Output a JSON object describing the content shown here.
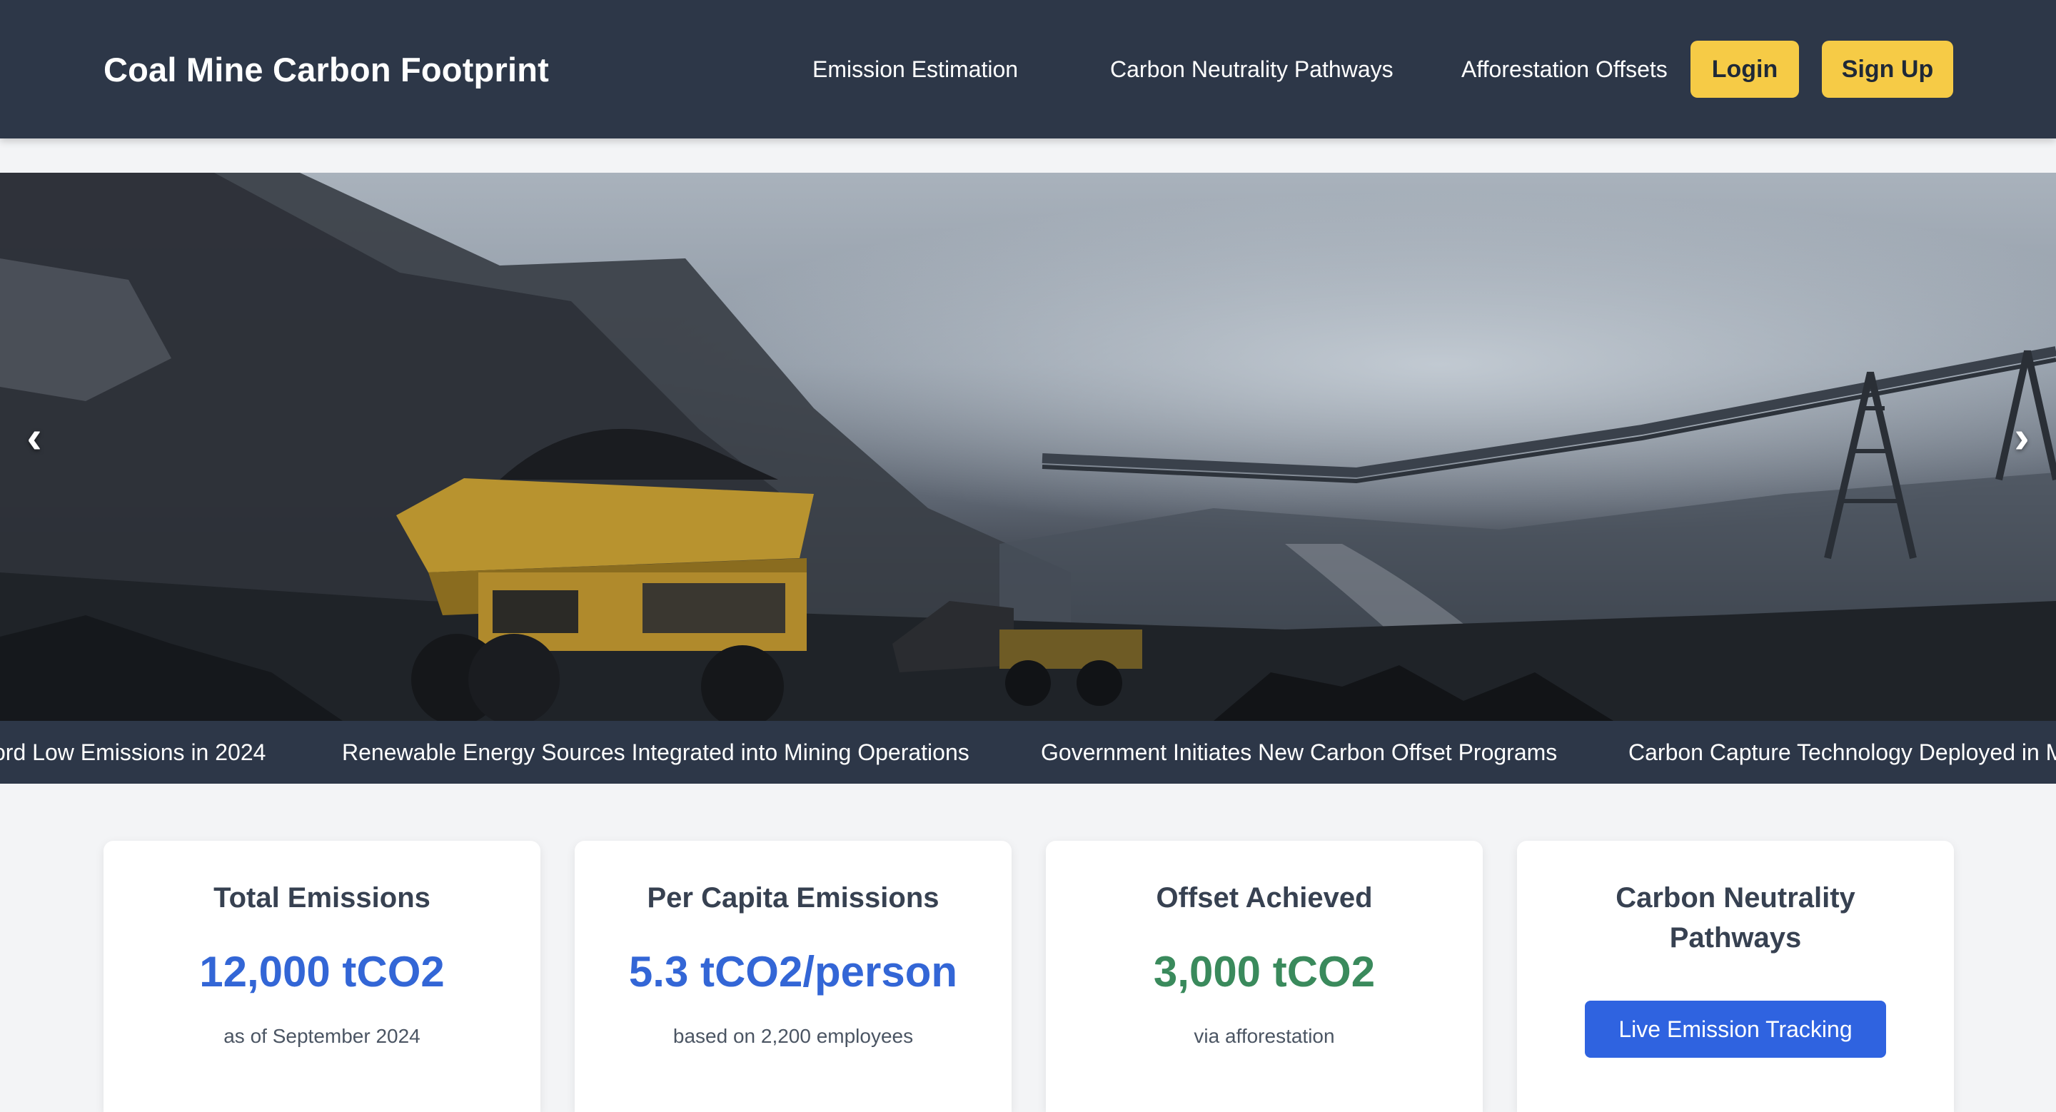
{
  "header": {
    "brand": "Coal Mine Carbon Footprint",
    "nav": [
      "Emission Estimation",
      "Carbon Neutrality Pathways",
      "Afforestation Offsets"
    ],
    "login_label": "Login",
    "signup_label": "Sign Up",
    "accent_color": "#f6cb46",
    "bg_color": "#2d3748"
  },
  "hero": {
    "prev_icon": "‹",
    "next_icon": "›"
  },
  "ticker": {
    "items": [
      "ord Low Emissions in 2024",
      "Renewable Energy Sources Integrated into Mining Operations",
      "Government Initiates New Carbon Offset Programs",
      "Carbon Capture Technology Deployed in M"
    ]
  },
  "cards": [
    {
      "title": "Total Emissions",
      "value": "12,000 tCO2",
      "sub": "as of September 2024"
    },
    {
      "title": "Per Capita Emissions",
      "value": "5.3 tCO2/person",
      "sub": "based on 2,200 employees"
    },
    {
      "title": "Offset Achieved",
      "value": "3,000 tCO2",
      "sub": "via afforestation"
    },
    {
      "title_line1": "Carbon Neutrality",
      "title_line2": "Pathways",
      "button": "Live Emission Tracking"
    }
  ]
}
